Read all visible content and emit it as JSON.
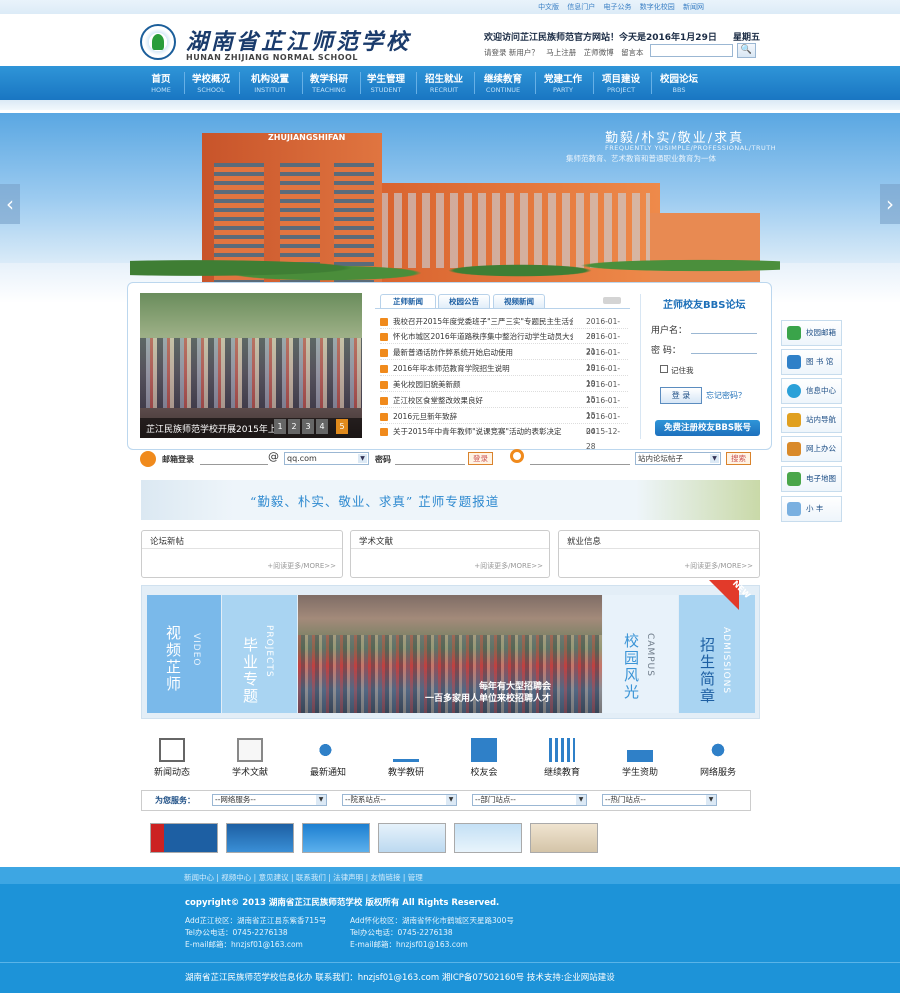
{
  "top": {
    "links": [
      "中文版",
      "信息门户",
      "电子公务",
      "数字化校园",
      "新闻网"
    ],
    "logo_cn": "湖南省芷江师范学校",
    "logo_en": "HUNAN ZHIJIANG NORMAL SCHOOL",
    "welcome": "欢迎访问芷江民族师范官方网站！今天是2016年1月29日",
    "weekday": "星期五",
    "user_links": [
      "请登录 新用户？",
      "马上注册",
      "芷师微博",
      "留言本"
    ],
    "search_btn": "🔍"
  },
  "nav": [
    {
      "cn": "首页",
      "en": "HOME"
    },
    {
      "cn": "学校概况",
      "en": "SCHOOL"
    },
    {
      "cn": "机构设置",
      "en": "INSTITUTI"
    },
    {
      "cn": "教学科研",
      "en": "TEACHING"
    },
    {
      "cn": "学生管理",
      "en": "STUDENT"
    },
    {
      "cn": "招生就业",
      "en": "RECRUIT"
    },
    {
      "cn": "继续教育",
      "en": "CONTINUE"
    },
    {
      "cn": "党建工作",
      "en": "PARTY"
    },
    {
      "cn": "项目建设",
      "en": "PROJECT"
    },
    {
      "cn": "校园论坛",
      "en": "BBS"
    }
  ],
  "banner": {
    "sign": "ZHUJIANGSHIFAN",
    "slogan": "勤毅/朴实/敬业/求真",
    "slogan_en": "FREQUENTLY YUSIMPLE/PROFESSIONAL/TRUTH",
    "slogan_sub": "集师范教育、艺术教育和普通职业教育为一体",
    "prev": "‹",
    "next": "›"
  },
  "slideshow": {
    "caption": "芷江民族师范学校开展2015年上",
    "pages": [
      "1",
      "2",
      "3",
      "4",
      "5"
    ]
  },
  "news": {
    "tabs": [
      "芷师新闻",
      "校园公告",
      "视频新闻"
    ],
    "items": [
      {
        "title": "我校召开2015年度党委班子\"三严三实\"专题民主生活会",
        "date": "2016-01-28"
      },
      {
        "title": "怀化市城区2016年道路秩序集中整治行动学生动员大会",
        "date": "2016-01-21"
      },
      {
        "title": "最新普通话防作弊系统开始启动使用",
        "date": "2016-01-19"
      },
      {
        "title": "2016年毕本师范教育学院招生说明",
        "date": "2016-01-19"
      },
      {
        "title": "美化校园旧貌美新颜",
        "date": "2016-01-15"
      },
      {
        "title": "芷江校区食堂整改效果良好",
        "date": "2016-01-15"
      },
      {
        "title": "2016元旦新年致辞",
        "date": "2016-01-04"
      },
      {
        "title": "关于2015年中青年教师\"说课竞赛\"活动的表彰决定",
        "date": "2015-12-28"
      }
    ]
  },
  "login": {
    "title": "芷师校友BBS论坛",
    "user_label": "用户名：",
    "pass_label": "密    码：",
    "remember": "记住我",
    "login_btn": "登 录",
    "forgot": "忘记密码？",
    "register": "免费注册校友BBS账号"
  },
  "side": [
    "校园邮箱",
    "图 书 馆",
    "信息中心",
    "站内导航",
    "网上办公",
    "电子地图",
    "小    丰"
  ],
  "mailbar": {
    "label": "邮箱登录",
    "at": "@",
    "domain": "qq.com",
    "pw_label": "密码",
    "btn": "登录",
    "search_select": "站内论坛帖子",
    "search_btn": "搜索"
  },
  "special": "“勤毅、朴实、敬业、求真”  芷师专题报道",
  "boxes": [
    {
      "title": "论坛新帖",
      "more": "+阅读更多/MORE>>"
    },
    {
      "title": "学术文献",
      "more": "+阅读更多/MORE>>"
    },
    {
      "title": "就业信息",
      "more": "+阅读更多/MORE>>"
    }
  ],
  "features": [
    {
      "cn": "视频芷师",
      "en": "VIDEO"
    },
    {
      "cn": "毕业专题",
      "en": "PROJECTS"
    },
    {
      "cn": "校园风光",
      "en": "CAMPUS"
    },
    {
      "cn": "招生简章",
      "en": "ADMISSIONS"
    }
  ],
  "feature_photo_caption": "每年有大型招聘会\n一百多家用人单位来校招聘人才",
  "new_badge": "NEW",
  "icons": [
    {
      "label": "新闻动态",
      "icon": "newspaper-icon"
    },
    {
      "label": "学术文献",
      "icon": "document-icon"
    },
    {
      "label": "最新通知",
      "icon": "speaker-icon"
    },
    {
      "label": "教学教研",
      "icon": "abc-icon"
    },
    {
      "label": "校友会",
      "icon": "alumni-icon"
    },
    {
      "label": "继续教育",
      "icon": "bookshelf-icon"
    },
    {
      "label": "学生资助",
      "icon": "plant-icon"
    },
    {
      "label": "网络服务",
      "icon": "gears-icon"
    }
  ],
  "quick": {
    "label": "为您服务：",
    "selects": [
      "--网络服务--",
      "--院系站点--",
      "--部门站点--",
      "--热门站点--"
    ]
  },
  "footer": {
    "links": "新闻中心 | 视频中心 | 意见建议 | 联系我们 | 法律声明 | 友情链接 | 管理",
    "copyright": "copyright© 2013 湖南省芷江民族师范学校 版权所有 All Rights Reserved.",
    "addr1": [
      "Add芷江校区：湖南省芷江县东紫香715号",
      "Tel办公电话：0745-2276138",
      "E-mail邮箱：hnzjsf01@163.com"
    ],
    "addr2": [
      "Add怀化校区：湖南省怀化市鹤城区天星路300号",
      "Tel办公电话：0745-2276138",
      "E-mail邮箱：hnzjsf01@163.com"
    ],
    "bottom": "湖南省芷江民族师范学校信息化办 联系我们：hnzjsf01@163.com 湘ICP备07502160号 技术支持:企业网站建设"
  }
}
